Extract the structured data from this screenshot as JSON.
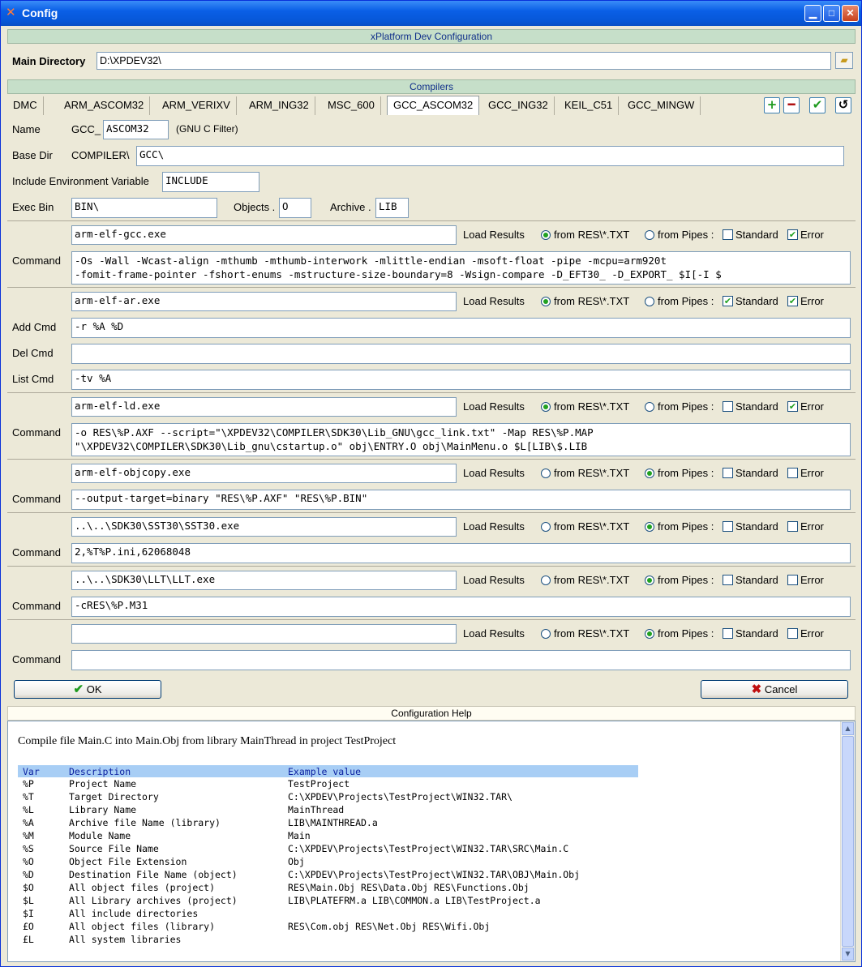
{
  "window": {
    "title": "Config"
  },
  "header": {
    "title": "xPlatform Dev Configuration"
  },
  "main_dir": {
    "label": "Main Directory",
    "value": "D:\\XPDEV32\\"
  },
  "compilers_band": "Compilers",
  "tabs": [
    "DMC",
    "ARM_ASCOM32",
    "ARM_VERIXV",
    "ARM_ING32",
    "MSC_600",
    "GCC_ASCOM32",
    "GCC_ING32",
    "KEIL_C51",
    "GCC_MINGW"
  ],
  "active_tab": "GCC_ASCOM32",
  "form": {
    "name_label": "Name",
    "name_prefix": "GCC_",
    "name_value": "ASCOM32",
    "name_note": "(GNU C Filter)",
    "basedir_label": "Base Dir",
    "basedir_prefix": "COMPILER\\",
    "basedir_value": "GCC\\",
    "include_label": "Include Environment Variable",
    "include_value": "INCLUDE",
    "execbin_label": "Exec Bin",
    "execbin_value": "BIN\\",
    "objects_label": "Objects .",
    "objects_value": "O",
    "archive_label": "Archive .",
    "archive_value": "LIB"
  },
  "labels": {
    "load_results": "Load Results",
    "from_res": "from RES\\*.TXT",
    "from_pipes": "from Pipes :",
    "standard": "Standard",
    "error": "Error",
    "command": "Command",
    "add_cmd": "Add Cmd",
    "del_cmd": "Del Cmd",
    "list_cmd": "List Cmd"
  },
  "compiler": {
    "exe": "arm-elf-gcc.exe",
    "cmd1": "-Os -Wall -Wcast-align -mthumb -mthumb-interwork -mlittle-endian -msoft-float -pipe -mcpu=arm920t",
    "cmd2": "-fomit-frame-pointer -fshort-enums -mstructure-size-boundary=8 -Wsign-compare -D_EFT30_ -D_EXPORT_ $I[-I $"
  },
  "archiver": {
    "exe": "arm-elf-ar.exe",
    "add": "-r %A %D",
    "del": "",
    "list": "-tv %A"
  },
  "linker": {
    "exe": "arm-elf-ld.exe",
    "cmd1": "-o RES\\%P.AXF --script=\"\\XPDEV32\\COMPILER\\SDK30\\Lib_GNU\\gcc_link.txt\" -Map RES\\%P.MAP",
    "cmd2": "\"\\XPDEV32\\COMPILER\\SDK30\\Lib_gnu\\cstartup.o\" obj\\ENTRY.O obj\\MainMenu.o $L[LIB\\$.LIB"
  },
  "objcopy": {
    "exe": "arm-elf-objcopy.exe",
    "cmd": "--output-target=binary \"RES\\%P.AXF\" \"RES\\%P.BIN\""
  },
  "sst": {
    "exe": "..\\..\\SDK30\\SST30\\SST30.exe",
    "cmd": "2,%T%P.ini,62068048"
  },
  "llt": {
    "exe": "..\\..\\SDK30\\LLT\\LLT.exe",
    "cmd": "-cRES\\%P.M31"
  },
  "extra": {
    "exe": "",
    "cmd": ""
  },
  "buttons": {
    "ok": "OK",
    "cancel": "Cancel"
  },
  "help": {
    "title": "Configuration Help",
    "subtitle": "Compile file Main.C into Main.Obj from library MainThread in project TestProject",
    "headers": [
      "Var",
      "Description",
      "Example value"
    ],
    "rows": [
      [
        "%P",
        "Project Name",
        "TestProject"
      ],
      [
        "%T",
        "Target Directory",
        "C:\\XPDEV\\Projects\\TestProject\\WIN32.TAR\\"
      ],
      [
        "%L",
        "Library Name",
        "MainThread"
      ],
      [
        "%A",
        "Archive file Name (library)",
        "LIB\\MAINTHREAD.a"
      ],
      [
        "%M",
        "Module Name",
        "Main"
      ],
      [
        "%S",
        "Source File Name",
        "C:\\XPDEV\\Projects\\TestProject\\WIN32.TAR\\SRC\\Main.C"
      ],
      [
        "%O",
        "Object File Extension",
        "Obj"
      ],
      [
        "%D",
        "Destination File Name (object)",
        "C:\\XPDEV\\Projects\\TestProject\\WIN32.TAR\\OBJ\\Main.Obj"
      ],
      [
        "$O",
        "All object files (project)",
        "RES\\Main.Obj RES\\Data.Obj RES\\Functions.Obj"
      ],
      [
        "$L",
        "All Library archives (project)",
        "LIB\\PLATEFRM.a LIB\\COMMON.a LIB\\TestProject.a"
      ],
      [
        "$I",
        "All include directories",
        ""
      ],
      [
        "£O",
        "All object files (library)",
        "RES\\Com.obj RES\\Net.Obj RES\\Wifi.Obj"
      ],
      [
        "£L",
        "All system libraries",
        ""
      ]
    ]
  }
}
